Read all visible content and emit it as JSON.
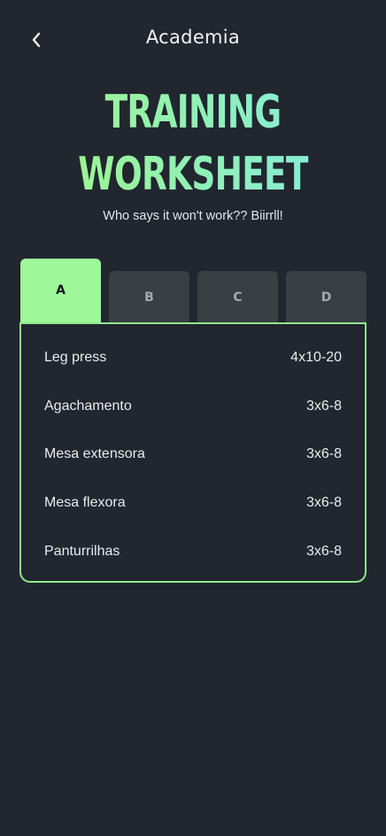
{
  "header": {
    "title": "Academia",
    "back_icon": "chevron-left-icon"
  },
  "hero": {
    "line1": "TRAINING",
    "line2": "WORKSHEET",
    "subtitle": "Who says it won't work?? Biirrll!"
  },
  "tabs": [
    {
      "label": "A",
      "active": true
    },
    {
      "label": "B",
      "active": false
    },
    {
      "label": "C",
      "active": false
    },
    {
      "label": "D",
      "active": false
    }
  ],
  "exercises": [
    {
      "name": "Leg press",
      "sets": "4x10-20"
    },
    {
      "name": "Agachamento",
      "sets": "3x6-8"
    },
    {
      "name": "Mesa extensora",
      "sets": "3x6-8"
    },
    {
      "name": "Mesa flexora",
      "sets": "3x6-8"
    },
    {
      "name": "Panturrilhas",
      "sets": "3x6-8"
    }
  ],
  "colors": {
    "background": "#21262f",
    "accent": "#9ef89a",
    "tab_inactive": "#3a3e45"
  }
}
